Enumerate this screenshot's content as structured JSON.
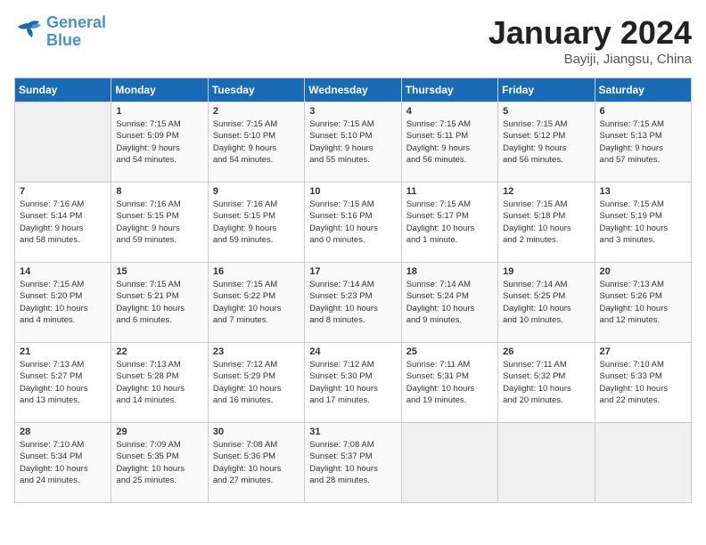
{
  "logo": {
    "text_general": "General",
    "text_blue": "Blue"
  },
  "title": "January 2024",
  "subtitle": "Bayiji, Jiangsu, China",
  "days_of_week": [
    "Sunday",
    "Monday",
    "Tuesday",
    "Wednesday",
    "Thursday",
    "Friday",
    "Saturday"
  ],
  "weeks": [
    [
      {
        "day": "",
        "content": ""
      },
      {
        "day": "1",
        "content": "Sunrise: 7:15 AM\nSunset: 5:09 PM\nDaylight: 9 hours\nand 54 minutes."
      },
      {
        "day": "2",
        "content": "Sunrise: 7:15 AM\nSunset: 5:10 PM\nDaylight: 9 hours\nand 54 minutes."
      },
      {
        "day": "3",
        "content": "Sunrise: 7:15 AM\nSunset: 5:10 PM\nDaylight: 9 hours\nand 55 minutes."
      },
      {
        "day": "4",
        "content": "Sunrise: 7:15 AM\nSunset: 5:11 PM\nDaylight: 9 hours\nand 56 minutes."
      },
      {
        "day": "5",
        "content": "Sunrise: 7:15 AM\nSunset: 5:12 PM\nDaylight: 9 hours\nand 56 minutes."
      },
      {
        "day": "6",
        "content": "Sunrise: 7:15 AM\nSunset: 5:13 PM\nDaylight: 9 hours\nand 57 minutes."
      }
    ],
    [
      {
        "day": "7",
        "content": "Sunrise: 7:16 AM\nSunset: 5:14 PM\nDaylight: 9 hours\nand 58 minutes."
      },
      {
        "day": "8",
        "content": "Sunrise: 7:16 AM\nSunset: 5:15 PM\nDaylight: 9 hours\nand 59 minutes."
      },
      {
        "day": "9",
        "content": "Sunrise: 7:16 AM\nSunset: 5:15 PM\nDaylight: 9 hours\nand 59 minutes."
      },
      {
        "day": "10",
        "content": "Sunrise: 7:15 AM\nSunset: 5:16 PM\nDaylight: 10 hours\nand 0 minutes."
      },
      {
        "day": "11",
        "content": "Sunrise: 7:15 AM\nSunset: 5:17 PM\nDaylight: 10 hours\nand 1 minute."
      },
      {
        "day": "12",
        "content": "Sunrise: 7:15 AM\nSunset: 5:18 PM\nDaylight: 10 hours\nand 2 minutes."
      },
      {
        "day": "13",
        "content": "Sunrise: 7:15 AM\nSunset: 5:19 PM\nDaylight: 10 hours\nand 3 minutes."
      }
    ],
    [
      {
        "day": "14",
        "content": "Sunrise: 7:15 AM\nSunset: 5:20 PM\nDaylight: 10 hours\nand 4 minutes."
      },
      {
        "day": "15",
        "content": "Sunrise: 7:15 AM\nSunset: 5:21 PM\nDaylight: 10 hours\nand 6 minutes."
      },
      {
        "day": "16",
        "content": "Sunrise: 7:15 AM\nSunset: 5:22 PM\nDaylight: 10 hours\nand 7 minutes."
      },
      {
        "day": "17",
        "content": "Sunrise: 7:14 AM\nSunset: 5:23 PM\nDaylight: 10 hours\nand 8 minutes."
      },
      {
        "day": "18",
        "content": "Sunrise: 7:14 AM\nSunset: 5:24 PM\nDaylight: 10 hours\nand 9 minutes."
      },
      {
        "day": "19",
        "content": "Sunrise: 7:14 AM\nSunset: 5:25 PM\nDaylight: 10 hours\nand 10 minutes."
      },
      {
        "day": "20",
        "content": "Sunrise: 7:13 AM\nSunset: 5:26 PM\nDaylight: 10 hours\nand 12 minutes."
      }
    ],
    [
      {
        "day": "21",
        "content": "Sunrise: 7:13 AM\nSunset: 5:27 PM\nDaylight: 10 hours\nand 13 minutes."
      },
      {
        "day": "22",
        "content": "Sunrise: 7:13 AM\nSunset: 5:28 PM\nDaylight: 10 hours\nand 14 minutes."
      },
      {
        "day": "23",
        "content": "Sunrise: 7:12 AM\nSunset: 5:29 PM\nDaylight: 10 hours\nand 16 minutes."
      },
      {
        "day": "24",
        "content": "Sunrise: 7:12 AM\nSunset: 5:30 PM\nDaylight: 10 hours\nand 17 minutes."
      },
      {
        "day": "25",
        "content": "Sunrise: 7:11 AM\nSunset: 5:31 PM\nDaylight: 10 hours\nand 19 minutes."
      },
      {
        "day": "26",
        "content": "Sunrise: 7:11 AM\nSunset: 5:32 PM\nDaylight: 10 hours\nand 20 minutes."
      },
      {
        "day": "27",
        "content": "Sunrise: 7:10 AM\nSunset: 5:33 PM\nDaylight: 10 hours\nand 22 minutes."
      }
    ],
    [
      {
        "day": "28",
        "content": "Sunrise: 7:10 AM\nSunset: 5:34 PM\nDaylight: 10 hours\nand 24 minutes."
      },
      {
        "day": "29",
        "content": "Sunrise: 7:09 AM\nSunset: 5:35 PM\nDaylight: 10 hours\nand 25 minutes."
      },
      {
        "day": "30",
        "content": "Sunrise: 7:08 AM\nSunset: 5:36 PM\nDaylight: 10 hours\nand 27 minutes."
      },
      {
        "day": "31",
        "content": "Sunrise: 7:08 AM\nSunset: 5:37 PM\nDaylight: 10 hours\nand 28 minutes."
      },
      {
        "day": "",
        "content": ""
      },
      {
        "day": "",
        "content": ""
      },
      {
        "day": "",
        "content": ""
      }
    ]
  ]
}
